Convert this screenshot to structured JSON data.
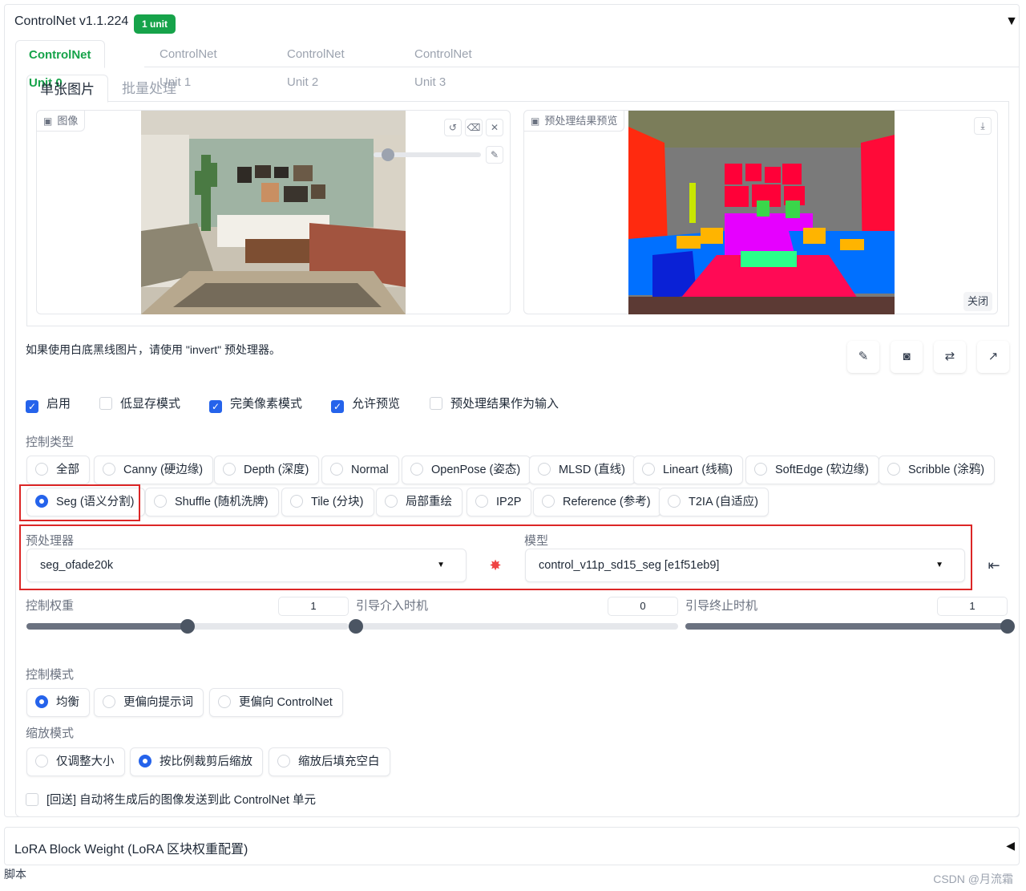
{
  "header": {
    "title": "ControlNet v1.1.224",
    "badge": "1 unit",
    "collapse_icon": "triangle-down"
  },
  "unit_tabs": [
    "ControlNet Unit 0",
    "ControlNet Unit 1",
    "ControlNet Unit 2",
    "ControlNet Unit 3"
  ],
  "sub_tabs": [
    "单张图片",
    "批量处理"
  ],
  "image_input": {
    "label": "图像"
  },
  "preview": {
    "label": "预处理结果预览",
    "close": "关闭"
  },
  "note": "如果使用白底黑线图片，请使用 \"invert\" 预处理器。",
  "checkboxes": [
    {
      "label": "启用",
      "checked": true
    },
    {
      "label": "低显存模式",
      "checked": false
    },
    {
      "label": "完美像素模式",
      "checked": true
    },
    {
      "label": "允许预览",
      "checked": true
    },
    {
      "label": "预处理结果作为输入",
      "checked": false
    }
  ],
  "control_type": {
    "label": "控制类型",
    "options": [
      "全部",
      "Canny (硬边缘)",
      "Depth (深度)",
      "Normal",
      "OpenPose (姿态)",
      "MLSD (直线)",
      "Lineart (线稿)",
      "SoftEdge (软边缘)",
      "Scribble (涂鸦)",
      "Seg (语义分割)",
      "Shuffle (随机洗牌)",
      "Tile (分块)",
      "局部重绘",
      "IP2P",
      "Reference (参考)",
      "T2IA (自适应)"
    ],
    "selected": "Seg (语义分割)"
  },
  "preprocessor": {
    "label": "预处理器",
    "value": "seg_ofade20k"
  },
  "model": {
    "label": "模型",
    "value": "control_v11p_sd15_seg [e1f51eb9]"
  },
  "sliders": [
    {
      "label": "控制权重",
      "value": "1",
      "fraction": 0.5
    },
    {
      "label": "引导介入时机",
      "value": "0",
      "fraction": 0.0
    },
    {
      "label": "引导终止时机",
      "value": "1",
      "fraction": 1.0
    }
  ],
  "control_mode": {
    "label": "控制模式",
    "options": [
      "均衡",
      "更偏向提示词",
      "更偏向 ControlNet"
    ],
    "selected": "均衡"
  },
  "resize_mode": {
    "label": "缩放模式",
    "options": [
      "仅调整大小",
      "按比例裁剪后缩放",
      "缩放后填充空白"
    ],
    "selected": "按比例裁剪后缩放"
  },
  "loopback": {
    "label": "[回送] 自动将生成后的图像发送到此 ControlNet 单元",
    "checked": false
  },
  "lora_section": "LoRA Block Weight (LoRA 区块权重配置)",
  "scripts_label": "脚本",
  "watermark": "CSDN @月流霜",
  "colors": {
    "accent": "#2563eb",
    "badge": "#16a34a",
    "highlight": "#dc2626"
  }
}
